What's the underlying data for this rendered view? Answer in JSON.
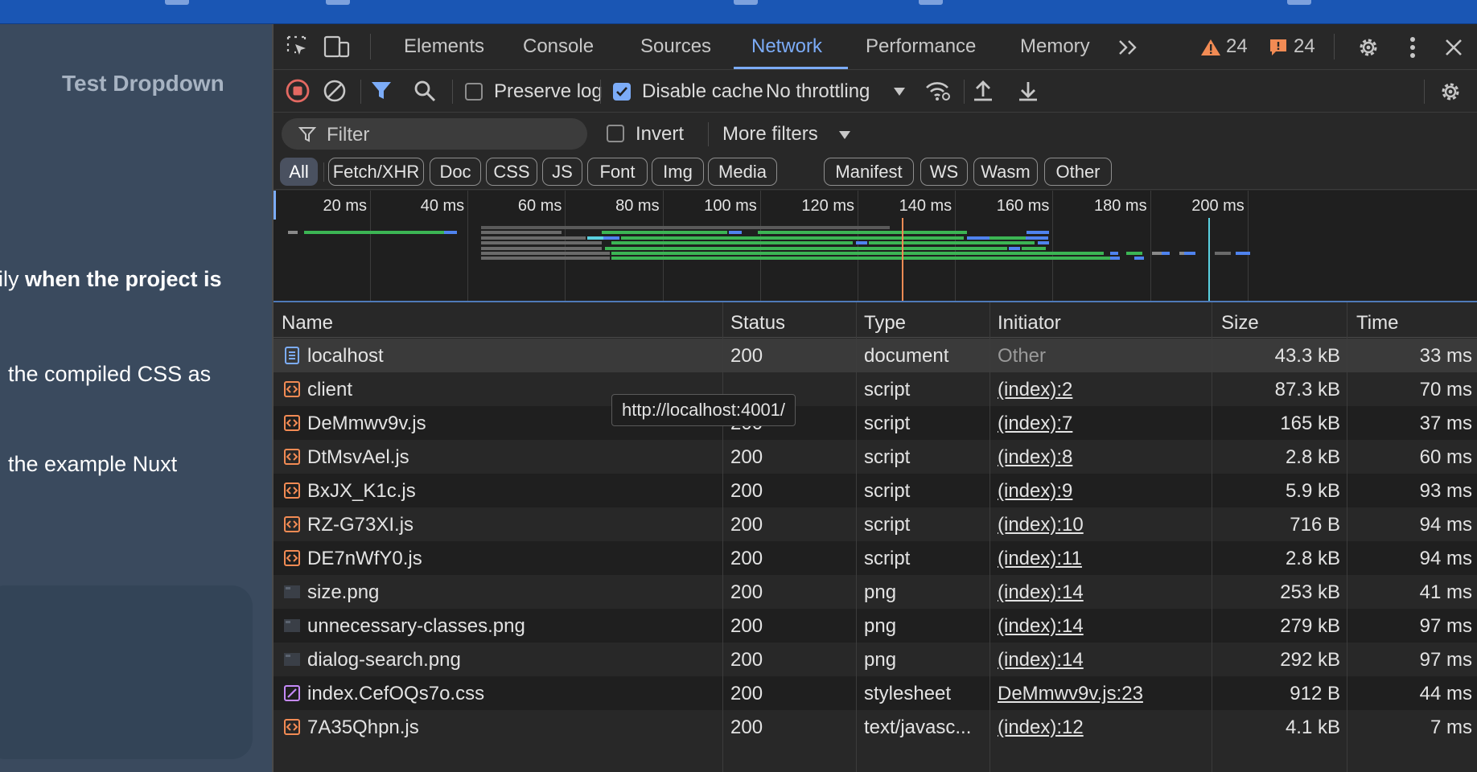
{
  "page": {
    "title": "Test Dropdown",
    "para1_prefix": "ily ",
    "para1_bold": "when the project is",
    "para2": "the compiled CSS as",
    "para3": "the example Nuxt"
  },
  "devtools": {
    "tabs": [
      "Elements",
      "Console",
      "Sources",
      "Network",
      "Performance",
      "Memory"
    ],
    "active_tab": "Network",
    "warnings_count": "24",
    "issues_count": "24",
    "toolbar": {
      "preserve_log": "Preserve log",
      "preserve_log_checked": false,
      "disable_cache": "Disable cache",
      "disable_cache_checked": true,
      "throttling": "No throttling"
    },
    "filter": {
      "placeholder": "Filter",
      "invert": "Invert",
      "more_filters": "More filters"
    },
    "type_filters": [
      "All",
      "Fetch/XHR",
      "Doc",
      "CSS",
      "JS",
      "Font",
      "Img",
      "Media",
      "Manifest",
      "WS",
      "Wasm",
      "Other"
    ],
    "active_type_filter": "All",
    "timeline_ticks": [
      "20 ms",
      "40 ms",
      "60 ms",
      "80 ms",
      "100 ms",
      "120 ms",
      "140 ms",
      "160 ms",
      "180 ms",
      "200 ms"
    ],
    "table": {
      "columns": [
        "Name",
        "Status",
        "Type",
        "Initiator",
        "Size",
        "Time"
      ],
      "rows": [
        {
          "name": "localhost",
          "kind": "doc",
          "status": "200",
          "type": "document",
          "initiator": "Other",
          "size": "43.3 kB",
          "time": "33 ms"
        },
        {
          "name": "client",
          "kind": "script",
          "status": "",
          "type": "script",
          "initiator": "(index):2",
          "size": "87.3 kB",
          "time": "70 ms"
        },
        {
          "name": "DeMmwv9v.js",
          "kind": "script",
          "status": "200",
          "type": "script",
          "initiator": "(index):7",
          "size": "165 kB",
          "time": "37 ms"
        },
        {
          "name": "DtMsvAel.js",
          "kind": "script",
          "status": "200",
          "type": "script",
          "initiator": "(index):8",
          "size": "2.8 kB",
          "time": "60 ms"
        },
        {
          "name": "BxJX_K1c.js",
          "kind": "script",
          "status": "200",
          "type": "script",
          "initiator": "(index):9",
          "size": "5.9 kB",
          "time": "93 ms"
        },
        {
          "name": "RZ-G73XI.js",
          "kind": "script",
          "status": "200",
          "type": "script",
          "initiator": "(index):10",
          "size": "716 B",
          "time": "94 ms"
        },
        {
          "name": "DE7nWfY0.js",
          "kind": "script",
          "status": "200",
          "type": "script",
          "initiator": "(index):11",
          "size": "2.8 kB",
          "time": "94 ms"
        },
        {
          "name": "size.png",
          "kind": "img",
          "status": "200",
          "type": "png",
          "initiator": "(index):14",
          "size": "253 kB",
          "time": "41 ms"
        },
        {
          "name": "unnecessary-classes.png",
          "kind": "img",
          "status": "200",
          "type": "png",
          "initiator": "(index):14",
          "size": "279 kB",
          "time": "97 ms"
        },
        {
          "name": "dialog-search.png",
          "kind": "img",
          "status": "200",
          "type": "png",
          "initiator": "(index):14",
          "size": "292 kB",
          "time": "97 ms"
        },
        {
          "name": "index.CefOQs7o.css",
          "kind": "css",
          "status": "200",
          "type": "stylesheet",
          "initiator": "DeMmwv9v.js:23",
          "size": "912 B",
          "time": "44 ms"
        },
        {
          "name": "7A35Qhpn.js",
          "kind": "script",
          "status": "200",
          "type": "text/javasc...",
          "initiator": "(index):12",
          "size": "4.1 kB",
          "time": "7 ms"
        }
      ]
    },
    "tooltip": "http://localhost:4001/"
  },
  "colors": {
    "accent": "#7cacf8",
    "warning": "#f28b54",
    "waterfall_green": "#3cb554",
    "waterfall_blue": "#4f83ef",
    "dcl_marker": "#f28b54",
    "load_marker": "#5ad1e0"
  }
}
